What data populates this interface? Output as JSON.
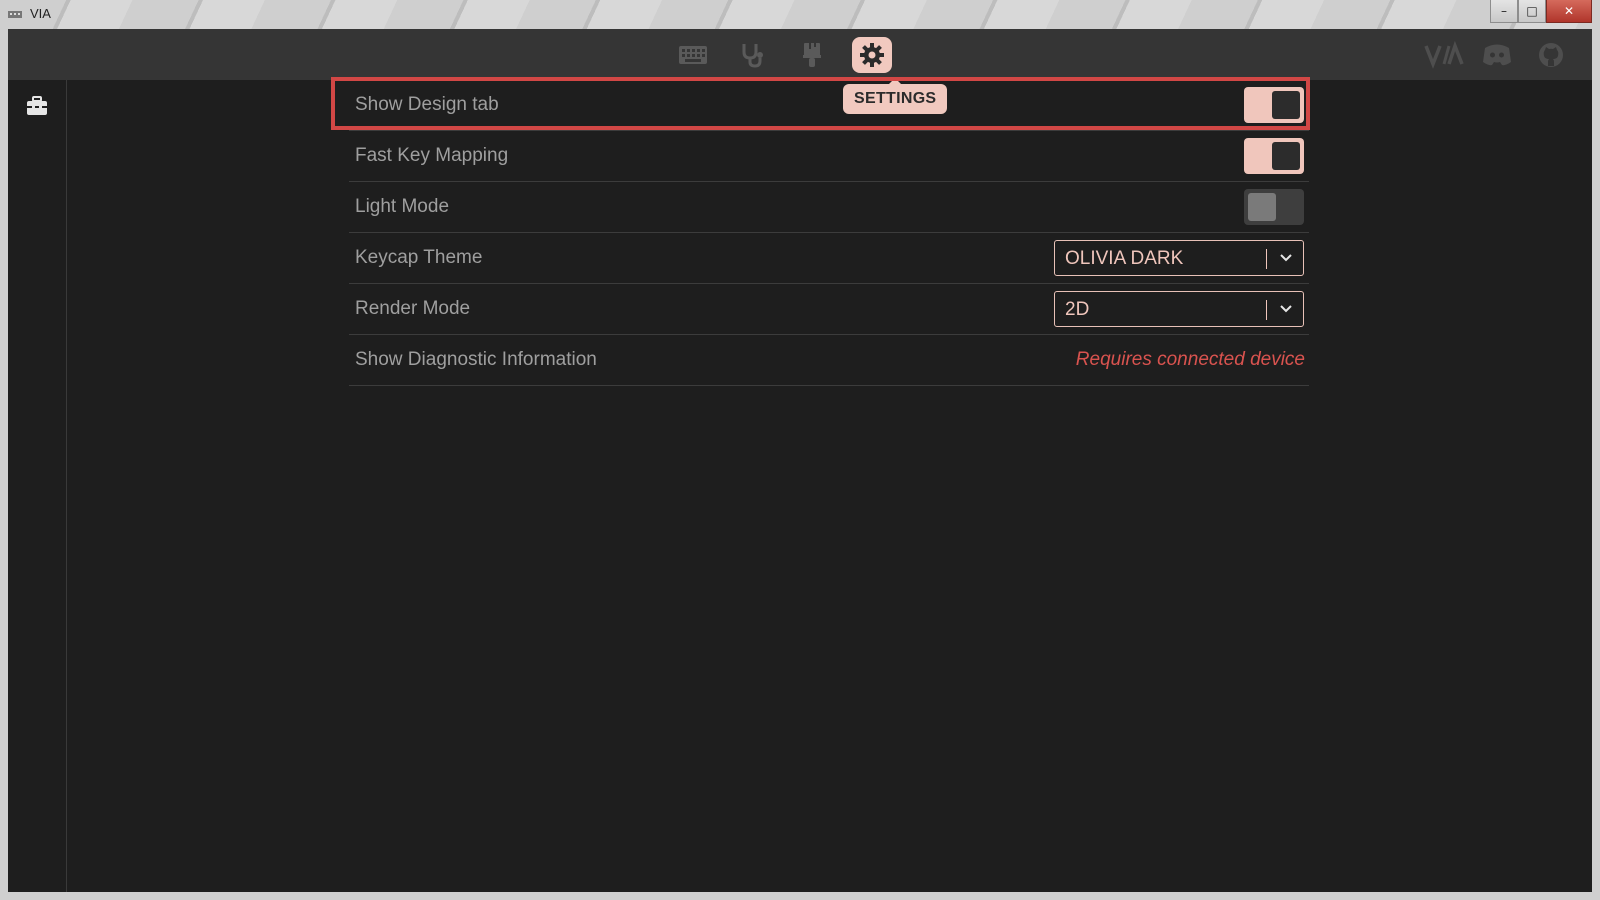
{
  "window": {
    "title": "VIA",
    "minimize": "–",
    "maximize": "□",
    "close": "✕"
  },
  "nav": {
    "items": [
      {
        "icon": "keyboard-icon",
        "active": false
      },
      {
        "icon": "stethoscope-icon",
        "active": false
      },
      {
        "icon": "paintbrush-icon",
        "active": false
      },
      {
        "icon": "gear-icon",
        "active": true
      }
    ],
    "tooltip": "SETTINGS",
    "right_icons": [
      "via-logo-icon",
      "discord-icon",
      "github-icon"
    ]
  },
  "sidebar": {
    "icon": "toolbox-icon"
  },
  "settings": [
    {
      "label": "Show Design tab",
      "type": "toggle",
      "value": true
    },
    {
      "label": "Fast Key Mapping",
      "type": "toggle",
      "value": true
    },
    {
      "label": "Light Mode",
      "type": "toggle",
      "value": false
    },
    {
      "label": "Keycap Theme",
      "type": "select",
      "value": "OLIVIA DARK"
    },
    {
      "label": "Render Mode",
      "type": "select",
      "value": "2D"
    },
    {
      "label": "Show Diagnostic Information",
      "type": "message",
      "value": "Requires connected device"
    }
  ],
  "colors": {
    "accent": "#f1c9bf",
    "highlight": "#d24745",
    "warning": "#d9534f",
    "background": "#1e1e1e",
    "header": "#353535"
  }
}
